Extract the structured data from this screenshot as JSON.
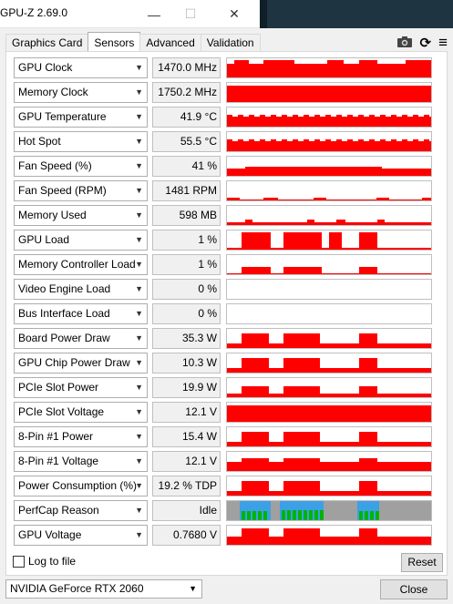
{
  "window": {
    "title": "GPU-Z 2.69.0",
    "minimize_glyph": "—",
    "maximize_glyph": "☐",
    "close_glyph": "✕"
  },
  "tabs": [
    {
      "label": "Graphics Card",
      "active": false
    },
    {
      "label": "Sensors",
      "active": true
    },
    {
      "label": "Advanced",
      "active": false
    },
    {
      "label": "Validation",
      "active": false
    }
  ],
  "toolbar": {
    "icons": [
      "camera-icon",
      "refresh-icon",
      "menu-icon"
    ],
    "refresh_glyph": "⟳",
    "menu_glyph": "≡"
  },
  "sensors": [
    {
      "label": "GPU Clock",
      "value": "1470.0 MHz",
      "graph": "clock"
    },
    {
      "label": "Memory Clock",
      "value": "1750.2 MHz",
      "graph": "full"
    },
    {
      "label": "GPU Temperature",
      "value": "41.9 °C",
      "graph": "temp"
    },
    {
      "label": "Hot Spot",
      "value": "55.5 °C",
      "graph": "temp"
    },
    {
      "label": "Fan Speed (%)",
      "value": "41 %",
      "graph": "fan"
    },
    {
      "label": "Fan Speed (RPM)",
      "value": "1481 RPM",
      "graph": "rpm"
    },
    {
      "label": "Memory Used",
      "value": "598 MB",
      "graph": "memused"
    },
    {
      "label": "GPU Load",
      "value": "1 %",
      "graph": "load"
    },
    {
      "label": "Memory Controller Load",
      "value": "1 %",
      "graph": "mcload"
    },
    {
      "label": "Video Engine Load",
      "value": "0 %",
      "graph": "none"
    },
    {
      "label": "Bus Interface Load",
      "value": "0 %",
      "graph": "none"
    },
    {
      "label": "Board Power Draw",
      "value": "35.3 W",
      "graph": "power"
    },
    {
      "label": "GPU Chip Power Draw",
      "value": "10.3 W",
      "graph": "power"
    },
    {
      "label": "PCIe Slot Power",
      "value": "19.9 W",
      "graph": "pcie"
    },
    {
      "label": "PCIe Slot Voltage",
      "value": "12.1 V",
      "graph": "full"
    },
    {
      "label": "8-Pin #1 Power",
      "value": "15.4 W",
      "graph": "power"
    },
    {
      "label": "8-Pin #1 Voltage",
      "value": "12.1 V",
      "graph": "voltage"
    },
    {
      "label": "Power Consumption (%)",
      "value": "19.2 % TDP",
      "graph": "power"
    },
    {
      "label": "PerfCap Reason",
      "value": "Idle",
      "graph": "perfcap"
    },
    {
      "label": "GPU Voltage",
      "value": "0.7680 V",
      "graph": "gpuvolt"
    }
  ],
  "footer": {
    "log_label": "Log to file",
    "log_checked": false,
    "reset_label": "Reset",
    "gpu_selected": "NVIDIA GeForce RTX 2060",
    "close_label": "Close"
  },
  "colors": {
    "graph_red": "#ff0000",
    "perfcap_gray": "#a0a0a0",
    "perfcap_blue": "#3ca0e6",
    "perfcap_green": "#00b400"
  }
}
